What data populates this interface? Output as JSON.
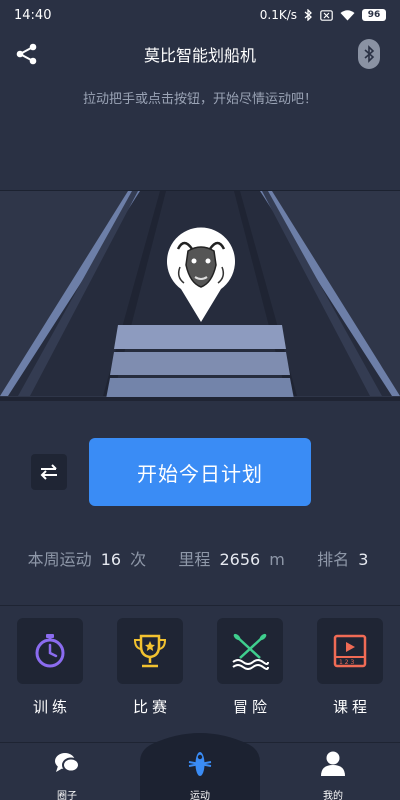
{
  "status_bar": {
    "time": "14:40",
    "network_speed": "0.1K/s",
    "battery": "96",
    "icons": [
      "bluetooth-icon",
      "no-sim-icon",
      "wifi-icon",
      "battery-icon"
    ]
  },
  "header": {
    "title": "莫比智能划船机",
    "left_icon": "share-icon",
    "right_icon": "bluetooth-icon"
  },
  "hint_text": "拉动把手或点击按钮，开始尽情运动吧！",
  "track": {
    "marker_icon": "bull-logo-marker"
  },
  "actions": {
    "swap_icon": "swap-arrows-icon",
    "start_label": "开始今日计划"
  },
  "stats": {
    "week_label": "本周运动",
    "week_count": "16",
    "week_unit": "次",
    "distance_label": "里程",
    "distance_value": "2656",
    "distance_unit": "m",
    "rank_label": "排名",
    "rank_value": "3"
  },
  "features": [
    {
      "label": "训练",
      "icon": "stopwatch-icon",
      "color": "#8b6cf0"
    },
    {
      "label": "比赛",
      "icon": "trophy-icon",
      "color": "#f2c230"
    },
    {
      "label": "冒险",
      "icon": "crossed-oars-icon",
      "color": "#3fcf8e"
    },
    {
      "label": "课程",
      "icon": "video-course-icon",
      "color": "#f06b55"
    }
  ],
  "tabs": [
    {
      "label": "圈子",
      "icon": "chat-bubbles-icon"
    },
    {
      "label": "运动",
      "icon": "rowing-boat-icon",
      "active": true
    },
    {
      "label": "我的",
      "icon": "user-icon"
    }
  ],
  "colors": {
    "background": "#2a3144",
    "primary_button": "#3a8cf5",
    "tile": "#1f2534",
    "active_tab": "#3a8cf5"
  }
}
